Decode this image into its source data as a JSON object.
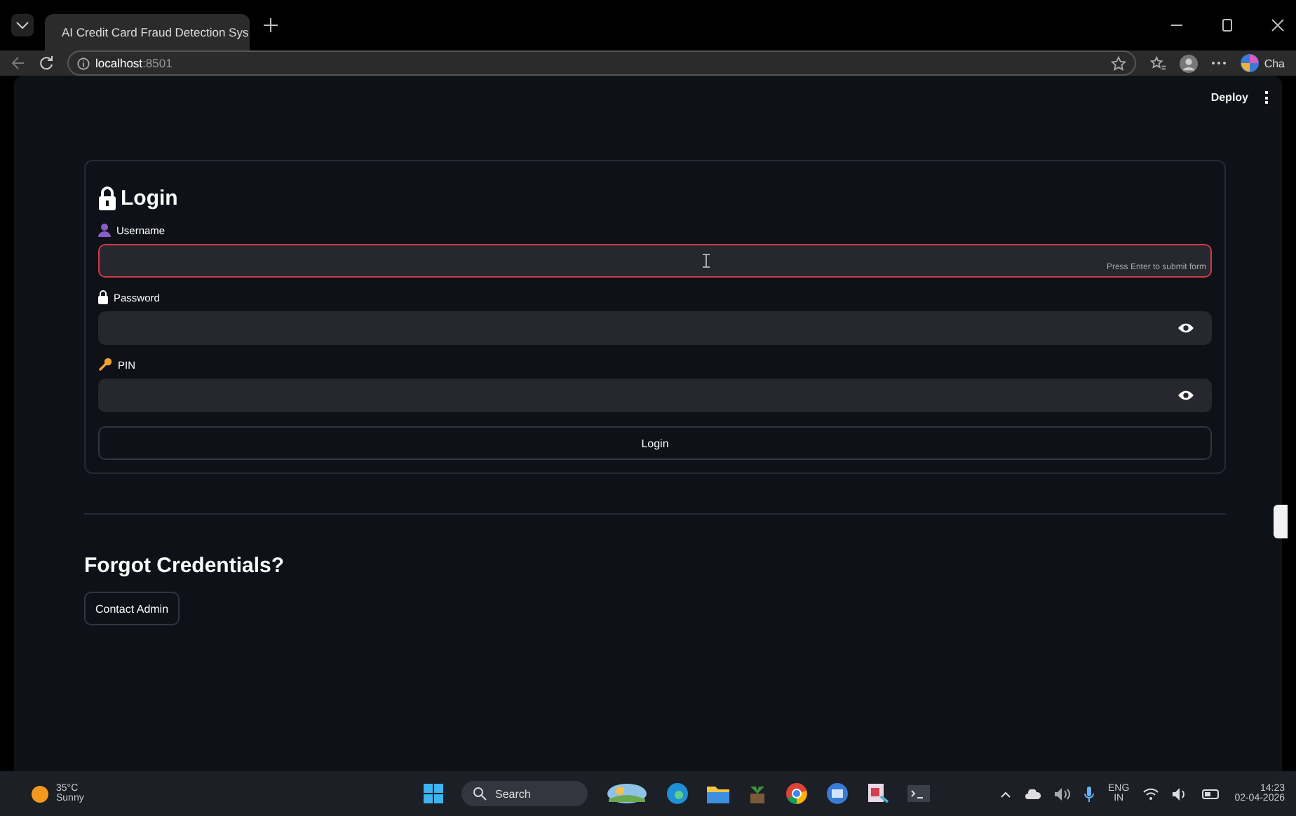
{
  "browser": {
    "tab_title": "AI Credit Card Fraud Detection Sys",
    "url_host": "localhost",
    "url_port": ":8501",
    "profile_label": "Cha"
  },
  "toolbar": {
    "deploy": "Deploy"
  },
  "login_form": {
    "title": "Login",
    "fields": [
      {
        "label": "Username",
        "kind": "text",
        "focused": true,
        "hint": "Press Enter to submit form"
      },
      {
        "label": "Password",
        "kind": "password",
        "focused": false
      },
      {
        "label": "PIN",
        "kind": "password",
        "focused": false
      }
    ],
    "submit": "Login"
  },
  "forgot": {
    "heading": "Forgot Credentials?",
    "button": "Contact Admin"
  },
  "taskbar": {
    "temperature": "35°C",
    "weather": "Sunny",
    "search": "Search",
    "lang": "ENG",
    "region": "IN",
    "time": "14:23",
    "date": "02-04-2026"
  }
}
